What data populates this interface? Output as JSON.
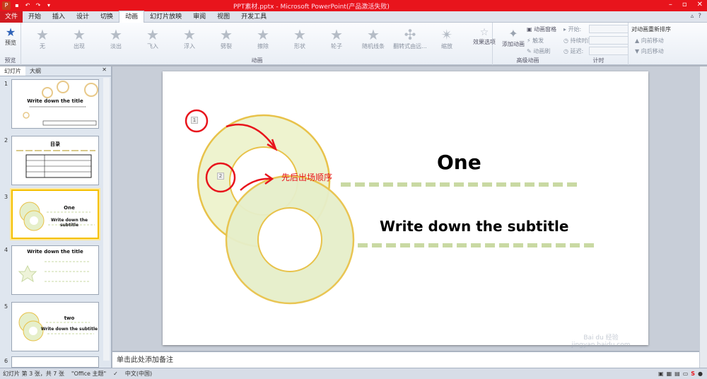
{
  "window": {
    "title": "PPT素材.pptx - Microsoft PowerPoint(产品激活失败)"
  },
  "menu": {
    "file": "文件",
    "tabs": [
      "开始",
      "插入",
      "设计",
      "切换",
      "动画",
      "幻灯片放映",
      "审阅",
      "视图",
      "开发工具"
    ],
    "active_index": 4
  },
  "ribbon": {
    "preview": {
      "label": "预览",
      "group": "预览"
    },
    "animations": [
      "无",
      "出现",
      "淡出",
      "飞入",
      "浮入",
      "劈裂",
      "擦除",
      "形状",
      "轮子",
      "随机线条",
      "翻转式由远...",
      "缩放"
    ],
    "animations_group": "动画",
    "effect_options": "效果选项",
    "advanced": {
      "add_animation": "添加动画",
      "pane": "动画窗格",
      "trigger": "触发",
      "painter": "动画刷",
      "group": "高级动画"
    },
    "timing": {
      "start": "开始:",
      "duration": "持续时间:",
      "delay": "延迟:",
      "group": "计时"
    },
    "reorder": {
      "title": "对动画重新排序",
      "earlier": "向前移动",
      "later": "向后移动"
    }
  },
  "left_pane": {
    "tabs": [
      "幻灯片",
      "大纲"
    ],
    "slides": [
      {
        "num": "1",
        "title": "Write down the title"
      },
      {
        "num": "2",
        "title": "目录"
      },
      {
        "num": "3",
        "title": "One",
        "sub": "Write down the subtitle"
      },
      {
        "num": "4",
        "title": "Write down the title"
      },
      {
        "num": "5",
        "title": "two",
        "sub": "Write down the subtitle"
      },
      {
        "num": "6",
        "title": ""
      }
    ]
  },
  "slide": {
    "title": "One",
    "subtitle": "Write down the subtitle",
    "annotation": "先后出场顺序",
    "tag1": "1",
    "tag2": "2"
  },
  "notes_placeholder": "单击此处添加备注",
  "status": {
    "slide_info": "幻灯片 第 3 张，共 7 张",
    "theme": "\"Office 主题\"",
    "language": "中文(中国)"
  },
  "watermark": "Bai du 经验 jingyan.baidu.com",
  "colors": {
    "titlebar": "#e8141c",
    "ring_outline": "#e8c24a",
    "ring_fill": "#e6efca",
    "dash": "#c9d9a3",
    "annotation_red": "#e8141c"
  }
}
